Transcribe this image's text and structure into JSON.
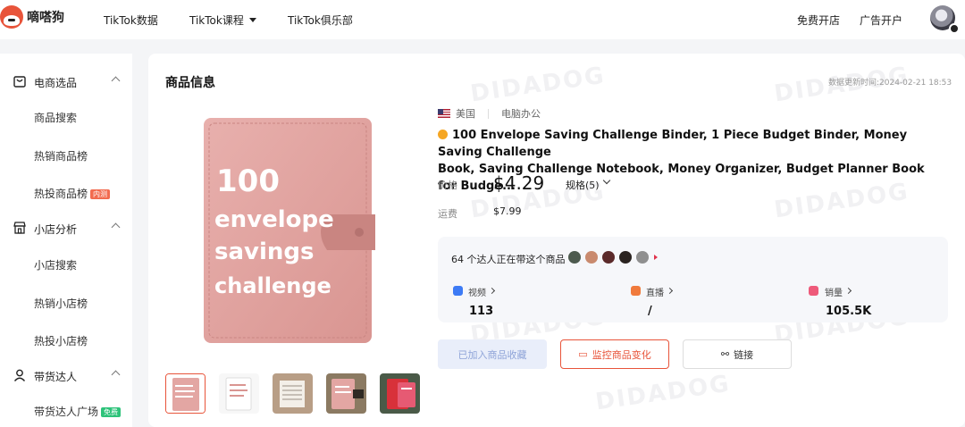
{
  "brand": {
    "name": "嘀嗒狗"
  },
  "nav": {
    "items": [
      "TikTok数据",
      "TikTok课程",
      "TikTok俱乐部"
    ],
    "right": [
      "免费开店",
      "广告开户"
    ]
  },
  "sidebar": {
    "groups": [
      {
        "label": "电商选品",
        "icon": "shopping-bag-icon",
        "items": [
          {
            "label": "商品搜索"
          },
          {
            "label": "热销商品榜"
          },
          {
            "label": "热投商品榜",
            "badge": "内测",
            "badge_color": "#f26b4f"
          }
        ]
      },
      {
        "label": "小店分析",
        "icon": "store-icon",
        "items": [
          {
            "label": "小店搜索"
          },
          {
            "label": "热销小店榜"
          },
          {
            "label": "热投小店榜"
          }
        ]
      },
      {
        "label": "带货达人",
        "icon": "person-icon",
        "items": [
          {
            "label": "带货达人广场",
            "badge": "免费",
            "badge_color": "#2ec37a"
          }
        ]
      }
    ]
  },
  "product": {
    "section_title": "商品信息",
    "updated": "数据更新时间:2024-02-21 18:53",
    "region": "美国",
    "category": "电脑办公",
    "title_line1": "100 Envelope Saving Challenge Binder, 1 Piece Budget Binder, Money Saving Challenge",
    "title_line2": "Book, Saving Challenge Notebook, Money Organizer, Budget Planner Book for Budge...",
    "price_label": "价格",
    "price": "$4.29",
    "spec": "规格(5)",
    "shipping_label": "运费",
    "shipping": "$7.99",
    "cover_text": [
      "100",
      "envelope",
      "savings",
      "challenge"
    ],
    "thumbnail_count": 5
  },
  "stats": {
    "kol_text": "64 个达人正在带这个商品",
    "metrics": [
      {
        "label": "视频",
        "value": "113",
        "color": "#3d7bf5"
      },
      {
        "label": "直播",
        "value": "/",
        "color": "#f07a3c"
      },
      {
        "label": "销量",
        "value": "105.5K",
        "color": "#ee5a7a"
      }
    ]
  },
  "actions": {
    "favorite": "已加入商品收藏",
    "monitor": "监控商品变化",
    "link": "链接"
  },
  "watermark": "DIDADOG",
  "colors": {
    "accent": "#e8543a",
    "page_bg": "#f4f5f7"
  }
}
